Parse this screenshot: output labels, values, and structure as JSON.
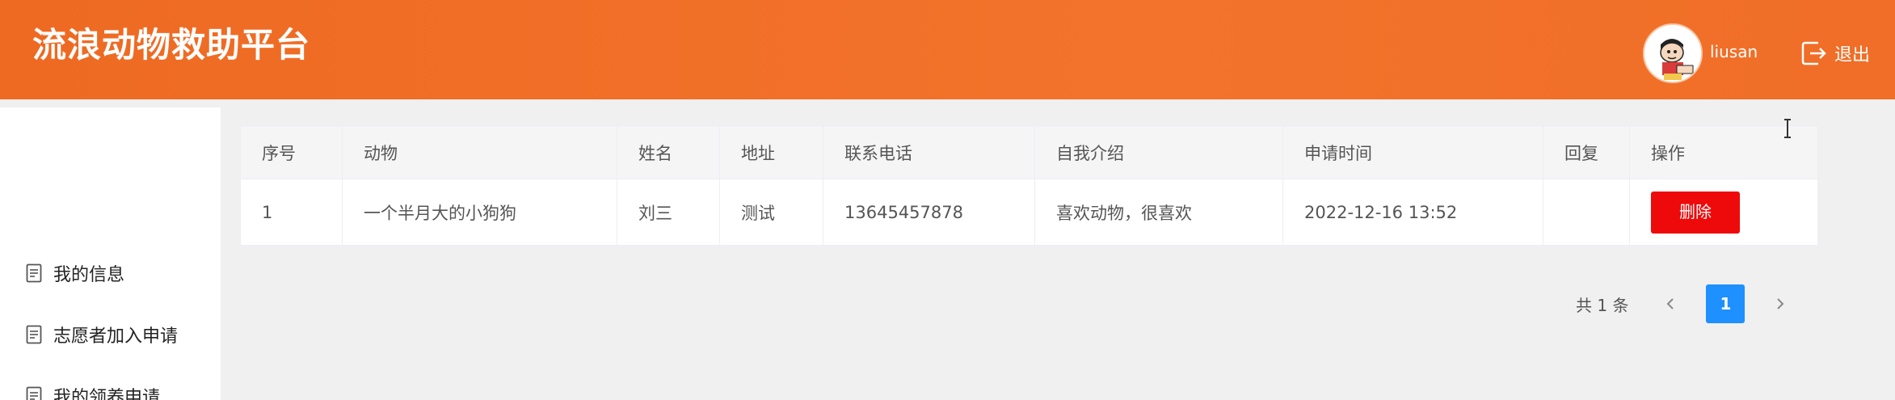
{
  "header": {
    "title": "流浪动物救助平台",
    "username": "liusan",
    "logout_label": "退出"
  },
  "sidebar": {
    "items": [
      {
        "label": "我的信息",
        "icon": "document-icon"
      },
      {
        "label": "志愿者加入申请",
        "icon": "document-icon"
      },
      {
        "label": "我的领养申请",
        "icon": "document-icon"
      }
    ]
  },
  "table": {
    "columns": [
      "序号",
      "动物",
      "姓名",
      "地址",
      "联系电话",
      "自我介绍",
      "申请时间",
      "回复",
      "操作"
    ],
    "rows": [
      {
        "index": "1",
        "animal": "一个半月大的小狗狗",
        "name": "刘三",
        "address": "测试",
        "phone": "13645457878",
        "intro": "喜欢动物，很喜欢",
        "time": "2022-12-16 13:52",
        "reply": "",
        "action_label": "删除"
      }
    ]
  },
  "pagination": {
    "total_text": "共 1 条",
    "current_page": "1"
  },
  "colors": {
    "header_orange": "#f06e27",
    "delete_red": "#ee0a0a",
    "page_active_blue": "#1e90ff"
  }
}
